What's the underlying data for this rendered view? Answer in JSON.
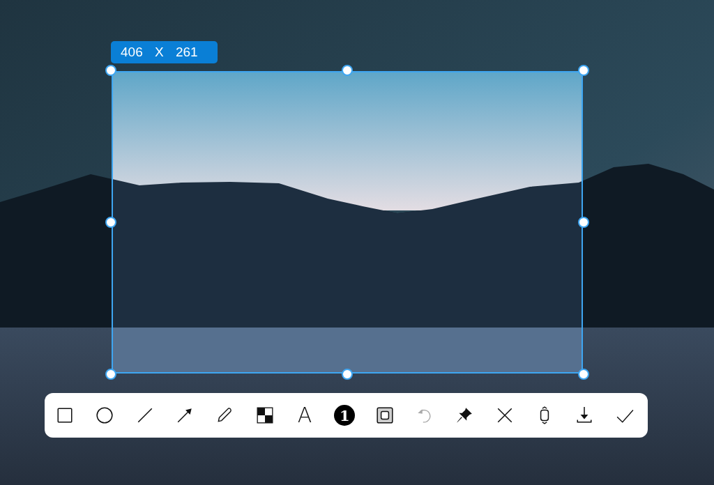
{
  "selection": {
    "size_label": "406 X 261"
  },
  "toolbar": {
    "tools": [
      {
        "kind": "rectangle",
        "disabled": false
      },
      {
        "kind": "ellipse",
        "disabled": false
      },
      {
        "kind": "line",
        "disabled": false
      },
      {
        "kind": "arrow",
        "disabled": false
      },
      {
        "kind": "pencil",
        "disabled": false
      },
      {
        "kind": "mosaic",
        "disabled": false
      },
      {
        "kind": "text",
        "label": "A",
        "disabled": false
      },
      {
        "kind": "number",
        "label": "1",
        "disabled": false
      },
      {
        "kind": "frame",
        "disabled": false
      },
      {
        "kind": "undo",
        "disabled": true
      },
      {
        "kind": "pin",
        "disabled": false
      },
      {
        "kind": "close",
        "disabled": false
      },
      {
        "kind": "scroll",
        "disabled": false
      },
      {
        "kind": "download",
        "disabled": false
      },
      {
        "kind": "confirm",
        "disabled": false
      }
    ]
  }
}
